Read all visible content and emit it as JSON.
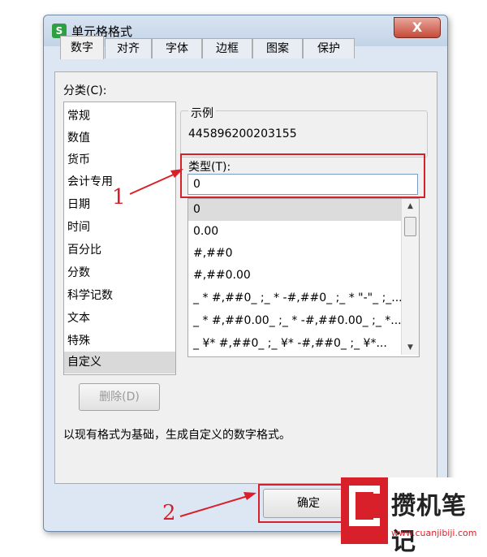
{
  "window": {
    "title": "单元格格式",
    "app_icon": "S",
    "close_label": "X"
  },
  "tabs": [
    {
      "label": "数字",
      "active": true
    },
    {
      "label": "对齐"
    },
    {
      "label": "字体"
    },
    {
      "label": "边框"
    },
    {
      "label": "图案"
    },
    {
      "label": "保护"
    }
  ],
  "category": {
    "label": "分类(C):",
    "items": [
      "常规",
      "数值",
      "货币",
      "会计专用",
      "日期",
      "时间",
      "百分比",
      "分数",
      "科学记数",
      "文本",
      "特殊",
      "自定义"
    ],
    "selected": "自定义"
  },
  "sample": {
    "label": "示例",
    "value": "445896200203155"
  },
  "type": {
    "label": "类型(T):",
    "value": "0",
    "options": [
      "0",
      "0.00",
      "#,##0",
      "#,##0.00",
      "_ * #,##0_ ;_ * -#,##0_ ;_ * \"-\"_ ;_...",
      "_ * #,##0.00_ ;_ * -#,##0.00_ ;_ *...",
      "_ ¥* #,##0_ ;_ ¥* -#,##0_ ;_ ¥*..."
    ]
  },
  "delete_button": "删除(D)",
  "description": "以现有格式为基础，生成自定义的数字格式。",
  "ok_button": "确定",
  "annotations": {
    "one": "1",
    "two": "2"
  },
  "watermark": {
    "text": "攒机笔记",
    "url": "www.cuanjibiji.com"
  },
  "colors": {
    "highlight": "#d8202a",
    "window_bg": "#dde7f3",
    "panel_bg": "#f0f0f0"
  }
}
